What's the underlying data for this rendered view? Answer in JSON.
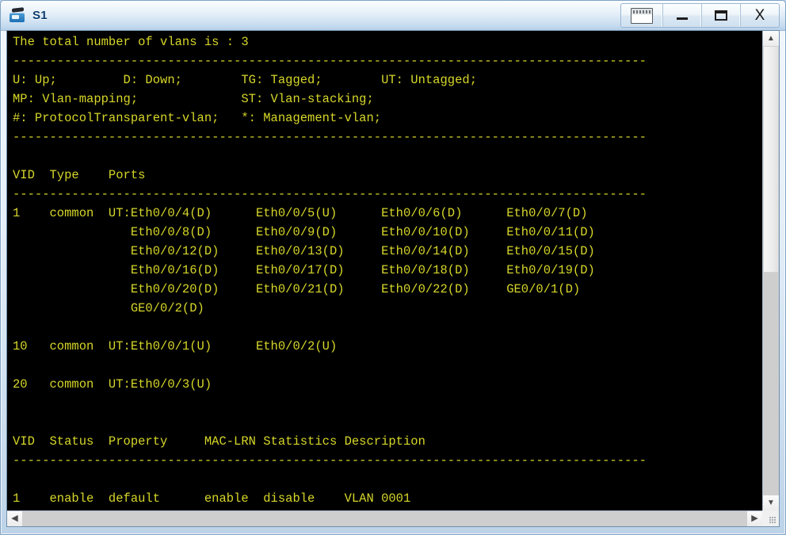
{
  "window": {
    "title": "S1",
    "app_icon": "switch-icon",
    "controls": [
      {
        "name": "keyboard-button",
        "label": ""
      },
      {
        "name": "minimize-button",
        "label": ""
      },
      {
        "name": "maximize-button",
        "label": ""
      },
      {
        "name": "close-button",
        "label": "X"
      }
    ]
  },
  "terminal": {
    "background_color": "#000000",
    "text_color": "#d6d62a",
    "content": "The total number of vlans is : 3\n--------------------------------------------------------------------------------------\nU: Up;         D: Down;        TG: Tagged;        UT: Untagged;\nMP: Vlan-mapping;              ST: Vlan-stacking;\n#: ProtocolTransparent-vlan;   *: Management-vlan;\n--------------------------------------------------------------------------------------\n\nVID  Type    Ports\n--------------------------------------------------------------------------------------\n1    common  UT:Eth0/0/4(D)      Eth0/0/5(U)      Eth0/0/6(D)      Eth0/0/7(D)\n                Eth0/0/8(D)      Eth0/0/9(D)      Eth0/0/10(D)     Eth0/0/11(D)\n                Eth0/0/12(D)     Eth0/0/13(D)     Eth0/0/14(D)     Eth0/0/15(D)\n                Eth0/0/16(D)     Eth0/0/17(D)     Eth0/0/18(D)     Eth0/0/19(D)\n                Eth0/0/20(D)     Eth0/0/21(D)     Eth0/0/22(D)     GE0/0/1(D)\n                GE0/0/2(D)\n\n10   common  UT:Eth0/0/1(U)      Eth0/0/2(U)\n\n20   common  UT:Eth0/0/3(U)\n\n\nVID  Status  Property     MAC-LRN Statistics Description\n--------------------------------------------------------------------------------------\n\n1    enable  default      enable  disable    VLAN 0001"
  },
  "terminal_lines": {
    "summary": "The total number of vlans is : 3",
    "total_vlans": 3,
    "legend": [
      "U: Up;",
      "D: Down;",
      "TG: Tagged;",
      "UT: Untagged;",
      "MP: Vlan-mapping;",
      "ST: Vlan-stacking;",
      "#: ProtocolTransparent-vlan;",
      "*: Management-vlan;"
    ],
    "ports_table": {
      "headers": [
        "VID",
        "Type",
        "Ports"
      ],
      "rows": [
        {
          "vid": "1",
          "type": "common",
          "tag": "UT:",
          "ports": [
            "Eth0/0/4(D)",
            "Eth0/0/5(U)",
            "Eth0/0/6(D)",
            "Eth0/0/7(D)",
            "Eth0/0/8(D)",
            "Eth0/0/9(D)",
            "Eth0/0/10(D)",
            "Eth0/0/11(D)",
            "Eth0/0/12(D)",
            "Eth0/0/13(D)",
            "Eth0/0/14(D)",
            "Eth0/0/15(D)",
            "Eth0/0/16(D)",
            "Eth0/0/17(D)",
            "Eth0/0/18(D)",
            "Eth0/0/19(D)",
            "Eth0/0/20(D)",
            "Eth0/0/21(D)",
            "Eth0/0/22(D)",
            "GE0/0/1(D)",
            "GE0/0/2(D)"
          ]
        },
        {
          "vid": "10",
          "type": "common",
          "tag": "UT:",
          "ports": [
            "Eth0/0/1(U)",
            "Eth0/0/2(U)"
          ]
        },
        {
          "vid": "20",
          "type": "common",
          "tag": "UT:",
          "ports": [
            "Eth0/0/3(U)"
          ]
        }
      ]
    },
    "status_table": {
      "headers": [
        "VID",
        "Status",
        "Property",
        "MAC-LRN",
        "Statistics",
        "Description"
      ],
      "rows": [
        {
          "vid": "1",
          "status": "enable",
          "property": "default",
          "mac_lrn": "enable",
          "statistics": "disable",
          "description": "VLAN 0001"
        }
      ]
    }
  },
  "scrollbars": {
    "vertical": {
      "up_arrow": "▲",
      "down_arrow": "▼"
    },
    "horizontal": {
      "left_arrow": "◀",
      "right_arrow": "▶"
    }
  }
}
